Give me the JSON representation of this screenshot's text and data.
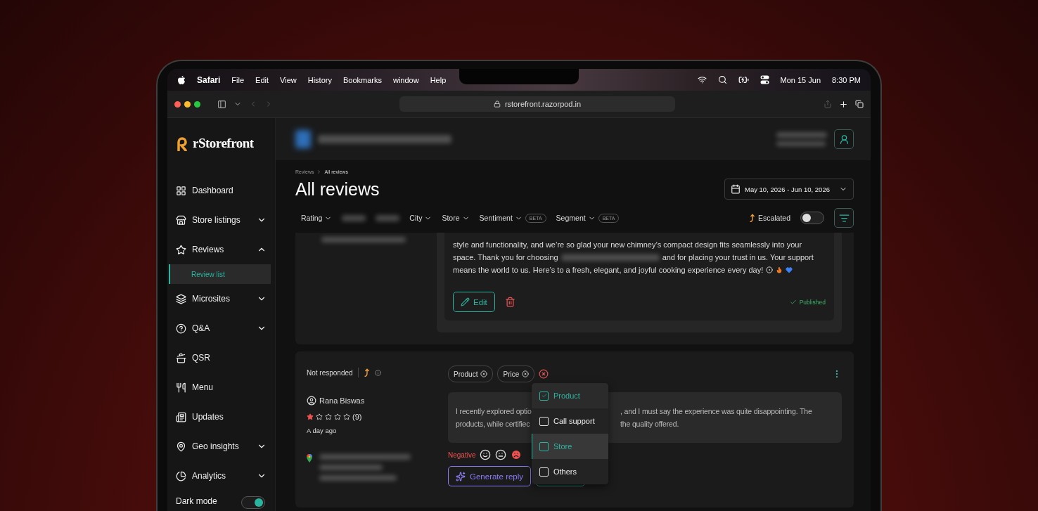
{
  "menubar": {
    "app": "Safari",
    "menus": [
      "File",
      "Edit",
      "View",
      "History",
      "Bookmarks",
      "window",
      "Help"
    ],
    "date": "Mon 15 Jun",
    "time": "8:30 PM"
  },
  "browser": {
    "url": "rstorefront.razorpod.in"
  },
  "brand": {
    "name": "rStorefront"
  },
  "sidebar": {
    "items": [
      {
        "label": "Dashboard",
        "kind": "link"
      },
      {
        "label": "Store listings",
        "kind": "group",
        "expanded": false
      },
      {
        "label": "Reviews",
        "kind": "group",
        "expanded": true,
        "children": [
          {
            "label": "Review list",
            "selected": true
          }
        ]
      },
      {
        "label": "Microsites",
        "kind": "group",
        "expanded": false
      },
      {
        "label": "Q&A",
        "kind": "group",
        "expanded": false
      },
      {
        "label": "QSR",
        "kind": "link"
      },
      {
        "label": "Menu",
        "kind": "link"
      },
      {
        "label": "Updates",
        "kind": "link"
      },
      {
        "label": "Geo insights",
        "kind": "group",
        "expanded": false
      },
      {
        "label": "Analytics",
        "kind": "group",
        "expanded": false
      }
    ],
    "dark_mode": {
      "label": "Dark mode",
      "on": true
    }
  },
  "breadcrumb": [
    "Reviews",
    "All reviews"
  ],
  "title": "All reviews",
  "date_range": "May 10, 2026 - Jun 10, 2026",
  "filters": [
    {
      "kind": "filter",
      "label": "Rating"
    },
    {
      "kind": "blurred"
    },
    {
      "kind": "blurred"
    },
    {
      "kind": "filter",
      "label": "City"
    },
    {
      "kind": "filter",
      "label": "Store"
    },
    {
      "kind": "filter",
      "label": "Sentiment",
      "badge": "BETA"
    },
    {
      "kind": "filter",
      "label": "Segment",
      "badge": "BETA"
    }
  ],
  "escalated": {
    "label": "Escalated",
    "on": false
  },
  "reviews": [
    {
      "response_lines": [
        {
          "parts": [
            "style and functionality, and we’re so glad your new chimney’s compact design fits seamlessly into your"
          ]
        },
        {
          "parts": [
            "space. Thank you for choosing",
            "and for placing your trust in us. Your support"
          ]
        },
        {
          "parts": [
            "means the world to us. Here’s to a fresh, elegant, and joyful cooking experience every day!"
          ]
        }
      ],
      "edit_label": "Edit",
      "status": "Published"
    },
    {
      "status": "Not responded",
      "tags": [
        {
          "label": "Product"
        },
        {
          "label": "Price"
        }
      ],
      "reviewer": "Rana Biswas",
      "stars": 1,
      "count": "(9)",
      "time": "A day ago",
      "text_left": [
        "I recently explored optio",
        "products, while certifiec"
      ],
      "text_right": [
        ", and I must say the experience was quite disappointing. The",
        "the quality offered."
      ],
      "sentiment": "Negative",
      "faces": [
        {
          "selected": false
        },
        {
          "selected": false
        },
        {
          "selected": true
        }
      ],
      "generate_label": "Generate reply",
      "dropdown": [
        {
          "label": "Product",
          "checked": true,
          "highlighted": false
        },
        {
          "label": "Call support",
          "checked": false,
          "highlighted": false
        },
        {
          "label": "Store",
          "checked": false,
          "highlighted": true
        },
        {
          "label": "Others",
          "checked": false,
          "highlighted": false
        }
      ]
    }
  ]
}
